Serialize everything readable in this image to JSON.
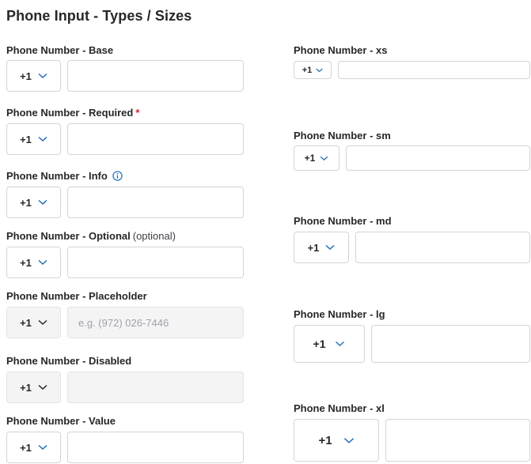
{
  "page": {
    "title": "Phone Input - Types / Sizes"
  },
  "country_code": "+1",
  "left": [
    {
      "label": "Phone Number - Base",
      "value": ""
    },
    {
      "label": "Phone Number - Required",
      "required_mark": "*",
      "value": ""
    },
    {
      "label": "Phone Number - Info",
      "icon": "info-circle-icon",
      "value": ""
    },
    {
      "label": "Phone Number - Optional",
      "optional_text": "(optional)",
      "value": ""
    },
    {
      "label": "Phone Number - Placeholder",
      "placeholder": "e.g. (972) 026-7446",
      "value": ""
    },
    {
      "label": "Phone Number - Disabled",
      "disabled": true,
      "value": ""
    },
    {
      "label": "Phone Number - Value",
      "value": ""
    }
  ],
  "right": [
    {
      "label": "Phone Number - xs",
      "size": "xs"
    },
    {
      "label": "Phone Number - sm",
      "size": "sm"
    },
    {
      "label": "Phone Number - md",
      "size": "md"
    },
    {
      "label": "Phone Number - lg",
      "size": "lg"
    },
    {
      "label": "Phone Number - xl",
      "size": "xl"
    }
  ],
  "colors": {
    "accent": "#1d6fb8",
    "required": "#e11d2e",
    "border": "#d4d4d8",
    "disabled_bg": "#f4f4f5"
  }
}
